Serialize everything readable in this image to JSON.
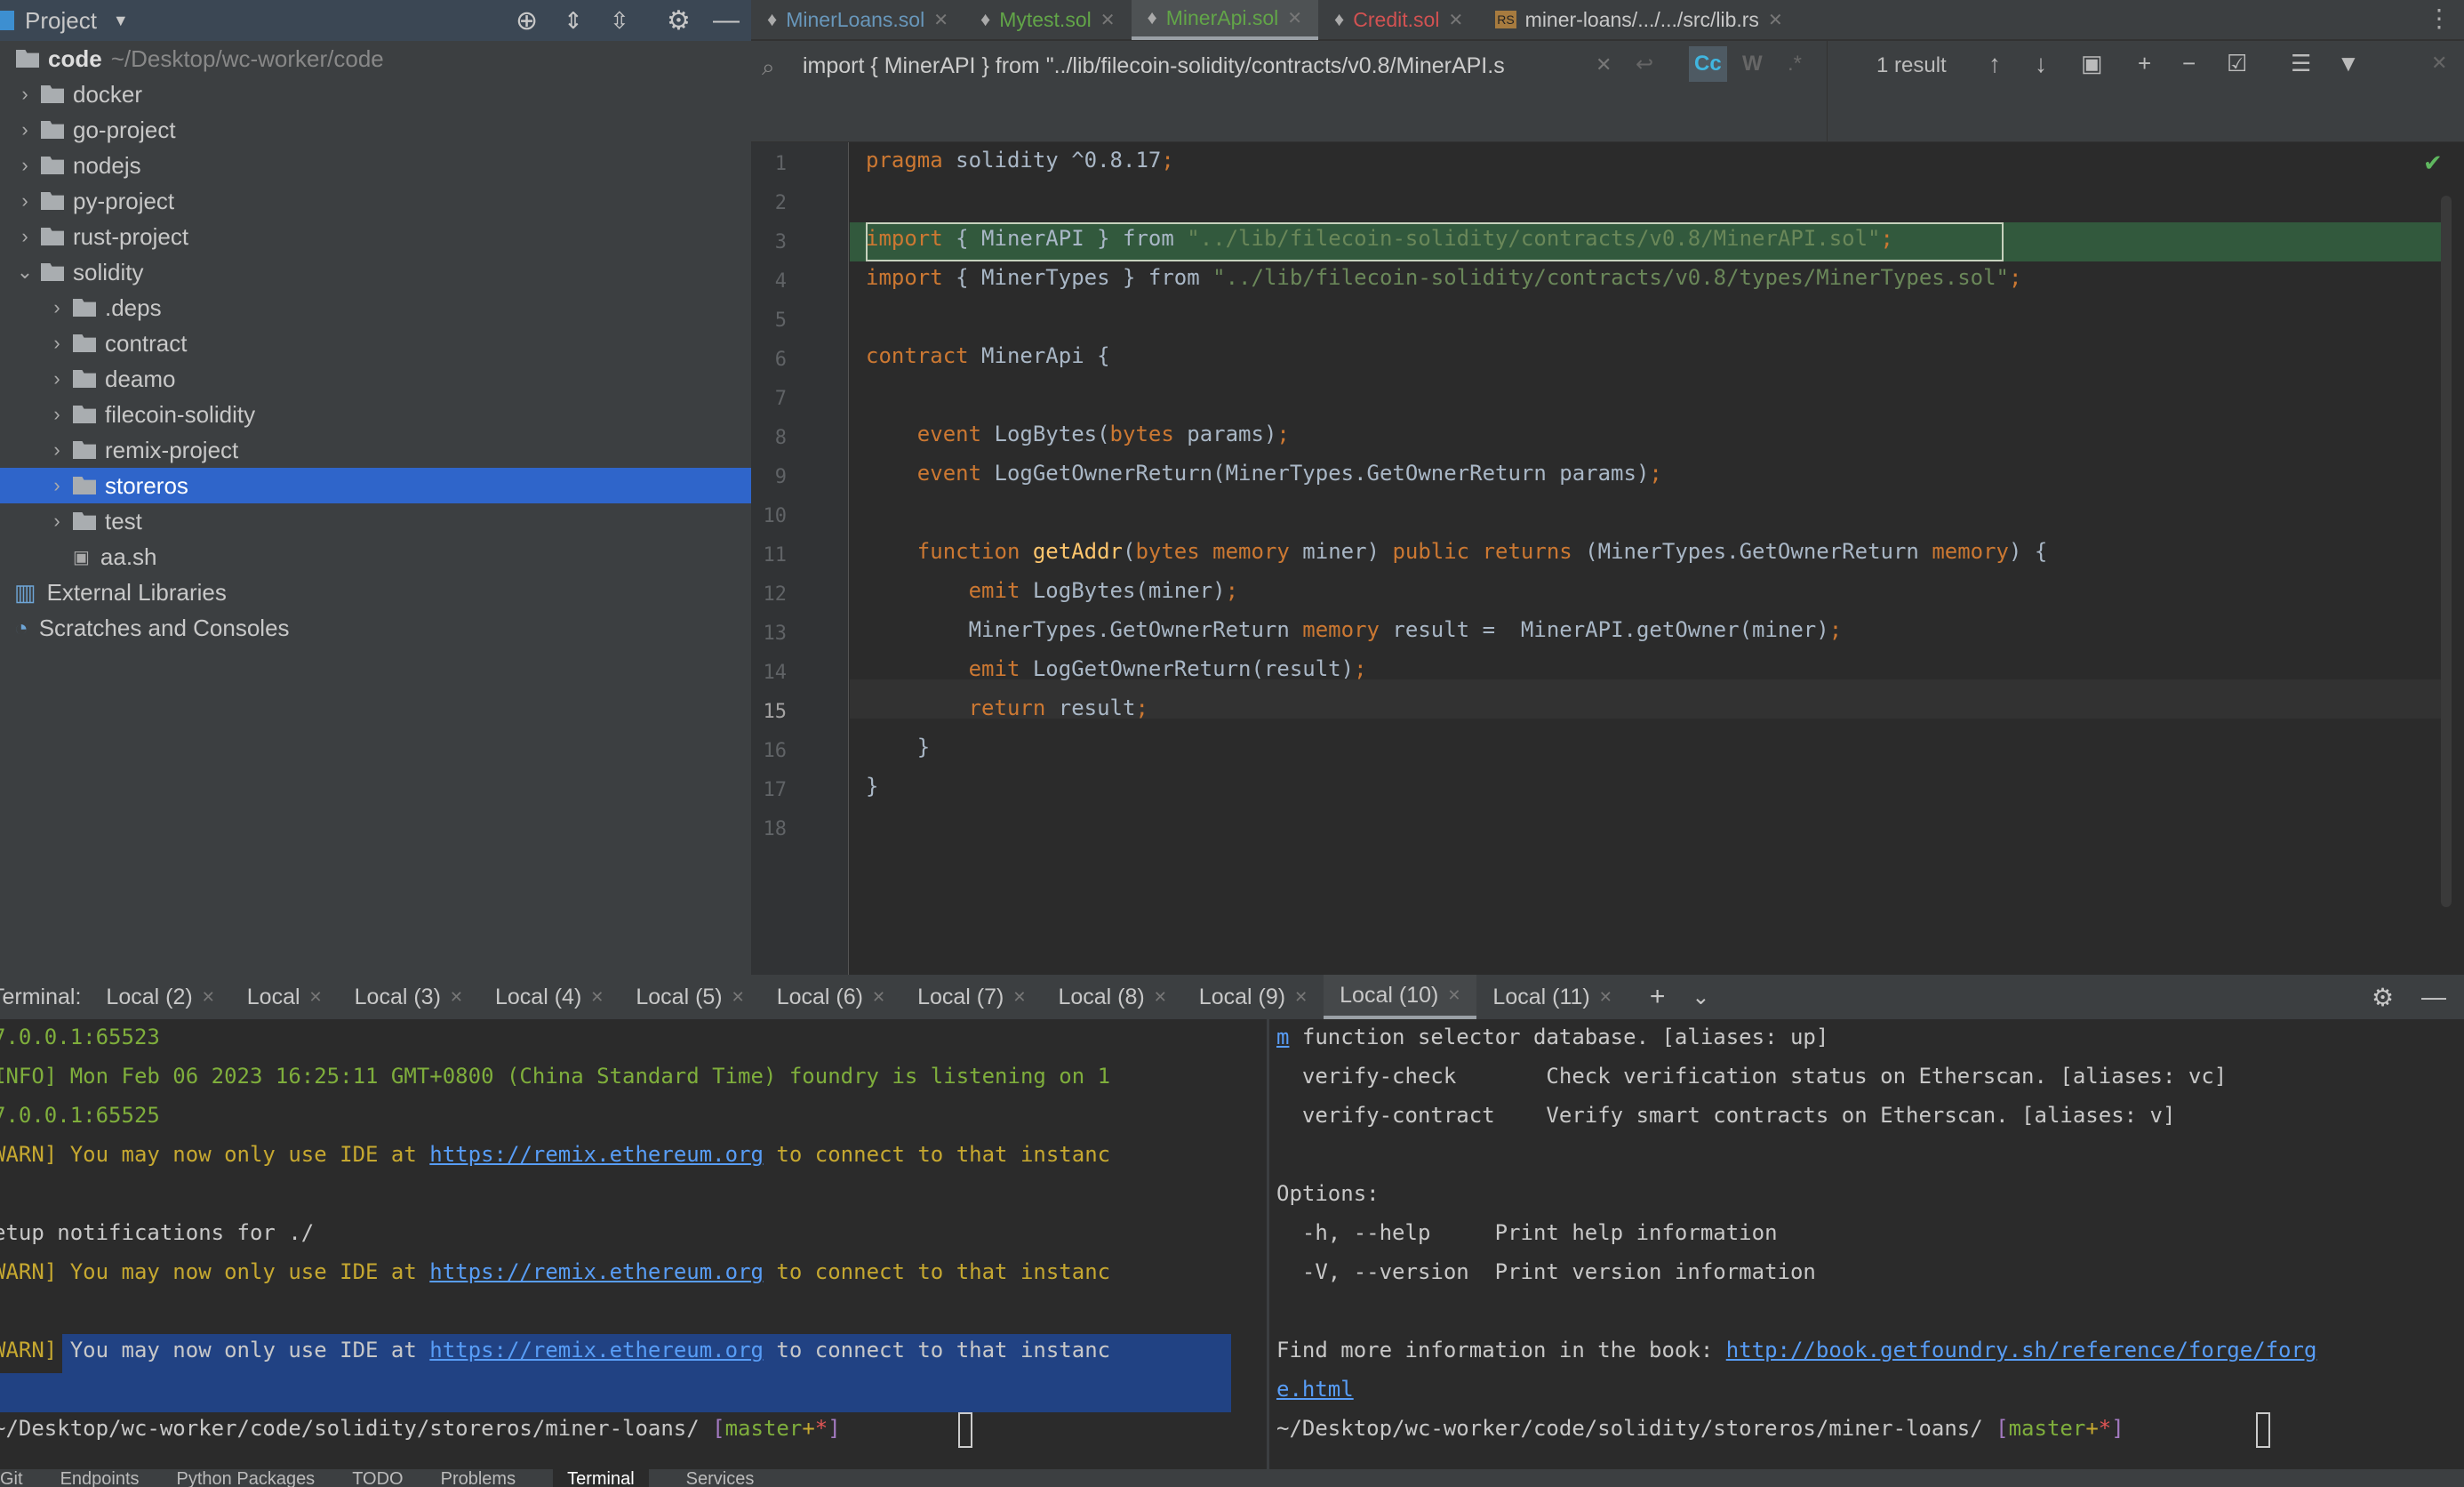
{
  "sidebar": {
    "title": "Project",
    "root_name": "code",
    "root_path": "~/Desktop/wc-worker/code",
    "items": [
      {
        "label": "docker",
        "depth": 1,
        "type": "folder",
        "expanded": false
      },
      {
        "label": "go-project",
        "depth": 1,
        "type": "folder",
        "expanded": false
      },
      {
        "label": "nodejs",
        "depth": 1,
        "type": "folder",
        "expanded": false
      },
      {
        "label": "py-project",
        "depth": 1,
        "type": "folder",
        "expanded": false
      },
      {
        "label": "rust-project",
        "depth": 1,
        "type": "folder",
        "expanded": false
      },
      {
        "label": "solidity",
        "depth": 1,
        "type": "folder",
        "expanded": true
      },
      {
        "label": ".deps",
        "depth": 2,
        "type": "folder",
        "expanded": false
      },
      {
        "label": "contract",
        "depth": 2,
        "type": "folder",
        "expanded": false
      },
      {
        "label": "deamo",
        "depth": 2,
        "type": "folder",
        "expanded": false
      },
      {
        "label": "filecoin-solidity",
        "depth": 2,
        "type": "folder",
        "expanded": false
      },
      {
        "label": "remix-project",
        "depth": 2,
        "type": "folder",
        "expanded": false
      },
      {
        "label": "storeros",
        "depth": 2,
        "type": "folder",
        "expanded": false,
        "selected": true
      },
      {
        "label": "test",
        "depth": 2,
        "type": "folder",
        "expanded": false
      },
      {
        "label": "aa.sh",
        "depth": 2,
        "type": "file"
      },
      {
        "label": "External Libraries",
        "depth": 0,
        "type": "lib"
      },
      {
        "label": "Scratches and Consoles",
        "depth": 0,
        "type": "scratch"
      }
    ]
  },
  "tabs": [
    {
      "label": "MinerLoans.sol",
      "color": "#6897bb"
    },
    {
      "label": "Mytest.sol",
      "color": "#62a548"
    },
    {
      "label": "MinerApi.sol",
      "color": "#62a548",
      "active": true
    },
    {
      "label": "Credit.sol",
      "color": "#d25252"
    },
    {
      "label": "miner-loans/.../.../src/lib.rs",
      "color": "#c8c8c8",
      "icon": "RS"
    }
  ],
  "search": {
    "query": "import { MinerAPI } from \"../lib/filecoin-solidity/contracts/v0.8/MinerAPI.s",
    "match_case": "Cc",
    "words": "W",
    "regex": ".*",
    "result": "1 result"
  },
  "editor": {
    "current_line": 15,
    "lines": [
      [
        [
          "pragma",
          "kw"
        ],
        [
          " solidity ^0.8.17",
          "pl"
        ],
        [
          ";",
          "kw"
        ]
      ],
      [],
      [
        [
          "import",
          "kw"
        ],
        [
          " { MinerAPI } from ",
          "pl"
        ],
        [
          "\"../lib/filecoin-solidity/contracts/v0.8/MinerAPI.sol\"",
          "str"
        ],
        [
          ";",
          "kw"
        ]
      ],
      [
        [
          "import",
          "kw"
        ],
        [
          " { MinerTypes } from ",
          "pl"
        ],
        [
          "\"../lib/filecoin-solidity/contracts/v0.8/types/MinerTypes.sol\"",
          "str"
        ],
        [
          ";",
          "kw"
        ]
      ],
      [],
      [
        [
          "contract",
          "kw"
        ],
        [
          " MinerApi {",
          "pl"
        ]
      ],
      [],
      [
        [
          "    event",
          "kw"
        ],
        [
          " LogBytes(",
          "pl"
        ],
        [
          "bytes",
          "kw"
        ],
        [
          " params)",
          "pl"
        ],
        [
          ";",
          "kw"
        ]
      ],
      [
        [
          "    event",
          "kw"
        ],
        [
          " LogGetOwnerReturn(MinerTypes.GetOwnerReturn params)",
          "pl"
        ],
        [
          ";",
          "kw"
        ]
      ],
      [],
      [
        [
          "    function ",
          "kw"
        ],
        [
          "getAddr",
          "fn"
        ],
        [
          "(",
          "pl"
        ],
        [
          "bytes memory",
          "kw"
        ],
        [
          " miner) ",
          "pl"
        ],
        [
          "public returns",
          "kw"
        ],
        [
          " (MinerTypes.GetOwnerReturn ",
          "pl"
        ],
        [
          "memory",
          "kw"
        ],
        [
          ") {",
          "pl"
        ]
      ],
      [
        [
          "        emit",
          "kw"
        ],
        [
          " LogBytes(miner)",
          "pl"
        ],
        [
          ";",
          "kw"
        ]
      ],
      [
        [
          "        MinerTypes.GetOwnerReturn ",
          "pl"
        ],
        [
          "memory",
          "kw"
        ],
        [
          " result =  MinerAPI.getOwner(miner)",
          "pl"
        ],
        [
          ";",
          "kw"
        ]
      ],
      [
        [
          "        emit",
          "kw"
        ],
        [
          " LogGetOwnerReturn(result)",
          "pl"
        ],
        [
          ";",
          "kw"
        ]
      ],
      [
        [
          "        return",
          "kw"
        ],
        [
          " result",
          "pl"
        ],
        [
          ";",
          "kw"
        ]
      ],
      [
        [
          "    }",
          "pl"
        ]
      ],
      [
        [
          "}",
          "pl"
        ]
      ],
      []
    ]
  },
  "terminal": {
    "label": "Terminal:",
    "tabs": [
      "Local (2)",
      "Local",
      "Local (3)",
      "Local (4)",
      "Local (5)",
      "Local (6)",
      "Local (7)",
      "Local (8)",
      "Local (9)",
      "Local (10)",
      "Local (11)"
    ],
    "active_tab": "Local (10)",
    "left": [
      [
        [
          "7.0.0.1:65523",
          "g"
        ]
      ],
      [
        [
          "INFO] Mon Feb 06 2023 16:25:11 GMT+0800 (China Standard Time) foundry is listening on 1",
          "g"
        ]
      ],
      [
        [
          "7.0.0.1:65525",
          "g"
        ]
      ],
      [
        [
          "WARN] You may now only use IDE at ",
          "y"
        ],
        [
          "https://remix.ethereum.org",
          "lnk"
        ],
        [
          " to connect to that instanc",
          "y"
        ]
      ],
      [],
      [
        [
          "etup notifications for ./",
          "w"
        ]
      ],
      [
        [
          "WARN] You may now only use IDE at ",
          "y"
        ],
        [
          "https://remix.ethereum.org",
          "lnk"
        ],
        [
          " to connect to that instanc",
          "y"
        ]
      ],
      [],
      [
        [
          "WARN]",
          "y"
        ],
        [
          " You may now only use IDE at ",
          "w"
        ],
        [
          "https://remix.ethereum.org",
          "lnk"
        ],
        [
          " to connect to that instanc",
          "w"
        ]
      ],
      [],
      [
        [
          "~/Desktop/wc-worker/code/solidity/storeros/miner-loans/ ",
          "w"
        ],
        [
          "[",
          "p"
        ],
        [
          "master",
          "g"
        ],
        [
          "+",
          "y"
        ],
        [
          "*",
          "r"
        ],
        [
          "]",
          "p"
        ]
      ]
    ],
    "right": [
      [
        [
          "m",
          "lnk"
        ],
        [
          " function selector database. [aliases: up]",
          "w"
        ]
      ],
      [
        [
          "  verify-check       Check verification status on Etherscan. [aliases: vc]",
          "w"
        ]
      ],
      [
        [
          "  verify-contract    Verify smart contracts on Etherscan. [aliases: v]",
          "w"
        ]
      ],
      [],
      [
        [
          "Options:",
          "w"
        ]
      ],
      [
        [
          "  -h, --help     Print help information",
          "w"
        ]
      ],
      [
        [
          "  -V, --version  Print version information",
          "w"
        ]
      ],
      [],
      [
        [
          "Find more information in the book: ",
          "w"
        ],
        [
          "http://book.getfoundry.sh/reference/forge/forg",
          "lnk"
        ]
      ],
      [
        [
          "e.html",
          "lnk"
        ]
      ],
      [
        [
          "~/Desktop/wc-worker/code/solidity/storeros/miner-loans/ ",
          "w"
        ],
        [
          "[",
          "p"
        ],
        [
          "master",
          "g"
        ],
        [
          "+",
          "y"
        ],
        [
          "*",
          "r"
        ],
        [
          "]",
          "p"
        ]
      ]
    ]
  },
  "bottom_bar": [
    "Git",
    "Endpoints",
    "Python Packages",
    "TODO",
    "Problems",
    "Terminal",
    "Services"
  ],
  "colors": {
    "selection": "#2f65ca",
    "search_match": "#32593d",
    "terminal_selection": "#214283"
  }
}
